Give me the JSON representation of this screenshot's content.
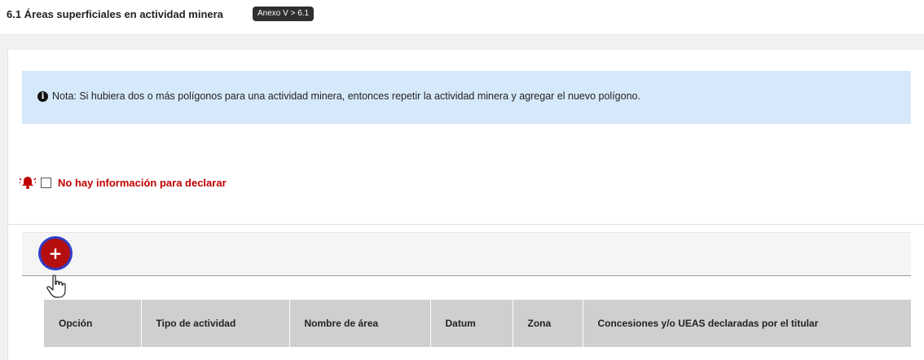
{
  "header": {
    "title": "6.1 Áreas superficiales en actividad minera",
    "badge": "Anexo V > 6.1"
  },
  "note": {
    "icon": "info-icon",
    "text": "Nota: Si hubiera dos o más polígonos para una actividad minera, entonces repetir la actividad minera y agregar el nuevo polígono."
  },
  "no_data": {
    "icon": "bell-icon",
    "checked": false,
    "label": "No hay información para declarar",
    "color": "#c00000"
  },
  "toolbar": {
    "add_label": "+",
    "add_icon": "plus-icon"
  },
  "table": {
    "columns": [
      "Opción",
      "Tipo de actividad",
      "Nombre de área",
      "Datum",
      "Zona",
      "Concesiones y/o UEAS declaradas por el titular"
    ]
  }
}
